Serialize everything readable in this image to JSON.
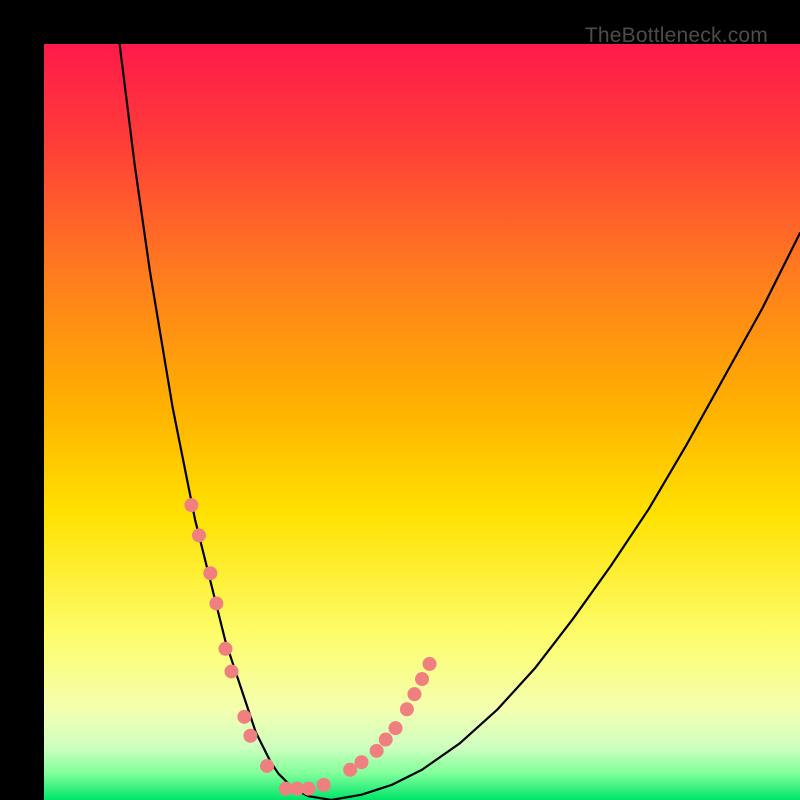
{
  "watermark": "TheBottleneck.com",
  "chart_data": {
    "type": "line",
    "title": "",
    "xlabel": "",
    "ylabel": "",
    "xlim": [
      0,
      100
    ],
    "ylim": [
      0,
      100
    ],
    "gradient": {
      "stops": [
        {
          "offset": 0.0,
          "color": "#ff1a4b"
        },
        {
          "offset": 0.12,
          "color": "#ff3a3a"
        },
        {
          "offset": 0.3,
          "color": "#ff7a1f"
        },
        {
          "offset": 0.48,
          "color": "#ffb100"
        },
        {
          "offset": 0.62,
          "color": "#ffe100"
        },
        {
          "offset": 0.78,
          "color": "#fdfd6a"
        },
        {
          "offset": 0.88,
          "color": "#f4ffb0"
        },
        {
          "offset": 0.93,
          "color": "#cfffc0"
        },
        {
          "offset": 0.965,
          "color": "#80ff9a"
        },
        {
          "offset": 1.0,
          "color": "#00e56a"
        }
      ]
    },
    "series": [
      {
        "name": "curve",
        "stroke": "#000000",
        "stroke_width": 2.2,
        "x": [
          10,
          11,
          12,
          13,
          14,
          15,
          16,
          17,
          18,
          19,
          20,
          21,
          22,
          23,
          24,
          25,
          26,
          27,
          28,
          29,
          30,
          31,
          33,
          35,
          38,
          42,
          46,
          50,
          55,
          60,
          65,
          70,
          75,
          80,
          85,
          90,
          95,
          100
        ],
        "y": [
          100,
          92,
          84,
          77,
          70,
          64,
          58,
          52,
          47,
          42,
          37,
          33,
          29,
          25,
          21,
          18,
          15,
          12,
          9,
          7,
          5,
          3.5,
          1.5,
          0.5,
          0,
          0.7,
          2.0,
          4.0,
          7.5,
          12.0,
          17.5,
          24.0,
          31.0,
          38.5,
          47.0,
          56.0,
          65.0,
          75.0
        ]
      }
    ],
    "curve_markers": {
      "color": "#f08080",
      "radius": 7,
      "points": [
        {
          "x": 19.5,
          "y": 39
        },
        {
          "x": 20.5,
          "y": 35
        },
        {
          "x": 22.0,
          "y": 30
        },
        {
          "x": 22.8,
          "y": 26
        },
        {
          "x": 24.0,
          "y": 20
        },
        {
          "x": 24.8,
          "y": 17
        },
        {
          "x": 26.5,
          "y": 11
        },
        {
          "x": 27.3,
          "y": 8.5
        },
        {
          "x": 29.5,
          "y": 4.5
        },
        {
          "x": 32.0,
          "y": 1.5
        },
        {
          "x": 33.5,
          "y": 1.5
        },
        {
          "x": 35.0,
          "y": 1.5
        },
        {
          "x": 37.0,
          "y": 2.0
        },
        {
          "x": 40.5,
          "y": 4.0
        },
        {
          "x": 42.0,
          "y": 5.0
        },
        {
          "x": 44.0,
          "y": 6.5
        },
        {
          "x": 45.2,
          "y": 8.0
        },
        {
          "x": 46.5,
          "y": 9.5
        },
        {
          "x": 48.0,
          "y": 12.0
        },
        {
          "x": 49.0,
          "y": 14.0
        },
        {
          "x": 50.0,
          "y": 16.0
        },
        {
          "x": 51.0,
          "y": 18.0
        }
      ]
    }
  }
}
